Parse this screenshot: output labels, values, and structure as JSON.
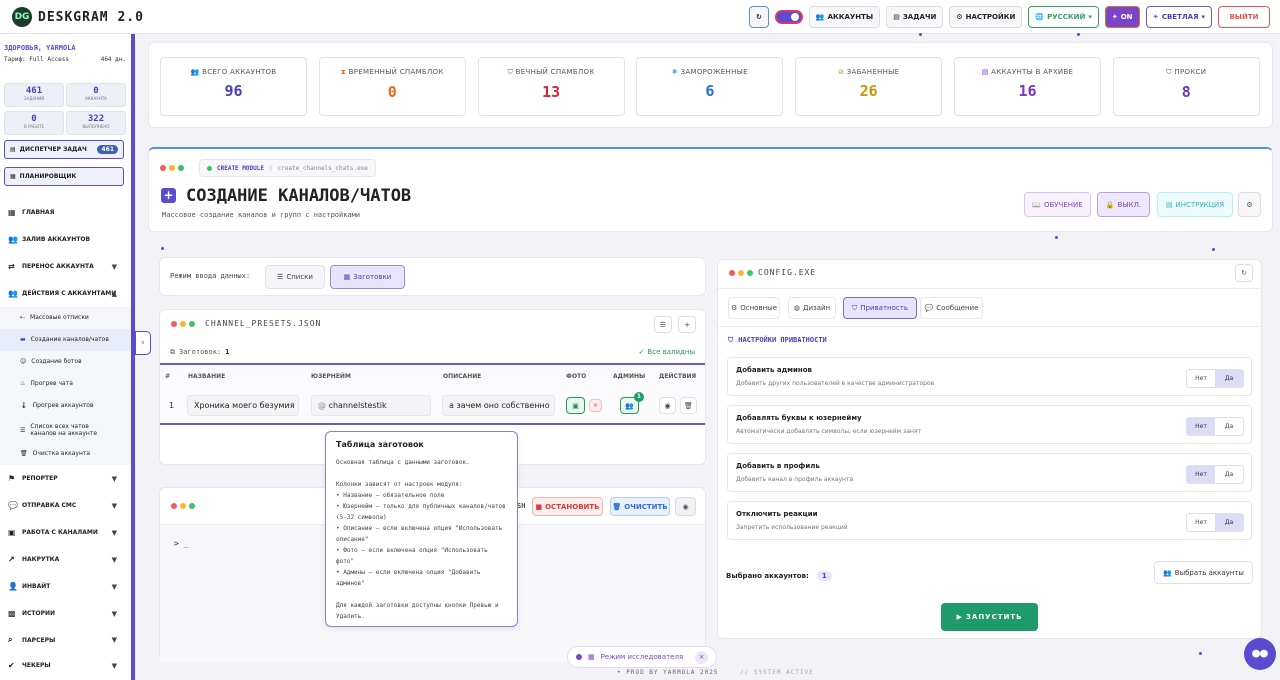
{
  "app": {
    "logo": "DG",
    "title": "DESKGRAM 2.0"
  },
  "topbar": {
    "accounts": "АККАУНТЫ",
    "tasks": "ЗАДАЧИ",
    "settings": "НАСТРОЙКИ",
    "language": "РУССКИЙ",
    "on": "ON",
    "theme": "СВЕТЛАЯ",
    "logout": "ВЫЙТИ"
  },
  "sidebar": {
    "user": "ЗДОРОВЬЯ, YARMOLA",
    "tariff_label": "Тариф: Full Access",
    "tariff_days": "464 дн.",
    "stats": [
      {
        "v": "461",
        "l": "заданий"
      },
      {
        "v": "0",
        "l": "аккаунта"
      },
      {
        "v": "0",
        "l": "в работе"
      },
      {
        "v": "322",
        "l": "выполнено"
      }
    ],
    "dispatcher": "ДИСПЕТЧЕР ЗАДАЧ",
    "dispatcher_count": "461",
    "planner": "ПЛАНИРОВЩИК",
    "items": [
      {
        "label": "ГЛАВНАЯ",
        "arrow": ""
      },
      {
        "label": "ЗАЛИВ АККАУНТОВ",
        "arrow": ""
      },
      {
        "label": "ПЕРЕНОС АККАУНТА",
        "arrow": "▼"
      },
      {
        "label": "ДЕЙСТВИЯ С АККАУНТАМИ",
        "arrow": "▲"
      }
    ],
    "subitems": [
      "Массовые отписки",
      "Создание каналов/чатов",
      "Создание ботов",
      "Прогрев чата",
      "Прогрев аккаунтов",
      "Список всех чатов каналов на аккаунте",
      "Очистка аккаунта"
    ],
    "items2": [
      "РЕПОРТЕР",
      "ОТПРАВКА СМС",
      "РАБОТА С КАНАЛАМИ",
      "НАКРУТКА",
      "ИНВАЙТ",
      "ИСТОРИИ",
      "ПАРСЕРЫ",
      "ЧЕКЕРЫ"
    ]
  },
  "stats_cards": [
    {
      "label": "ВСЕГО АККАУНТОВ",
      "value": "96",
      "color": "#4a3fb8"
    },
    {
      "label": "ВРЕМЕННЫЙ СПАМБЛОК",
      "value": "0",
      "color": "#e4691b"
    },
    {
      "label": "ВЕЧНЫЙ СПАМБЛОК",
      "value": "13",
      "color": "#d7263d"
    },
    {
      "label": "ЗАМОРОЖЕННЫЕ",
      "value": "6",
      "color": "#2b6fd6"
    },
    {
      "label": "ЗАБАНЕННЫЕ",
      "value": "26",
      "color": "#c29a0c"
    },
    {
      "label": "АККАУНТЫ В АРХИВЕ",
      "value": "16",
      "color": "#7b35c9"
    },
    {
      "label": "ПРОКСИ",
      "value": "8",
      "color": "#6a35c9"
    }
  ],
  "module": {
    "tag": "CREATE MODULE",
    "file": "create_channels_chats.exe",
    "title": "СОЗДАНИЕ КАНАЛОВ/ЧАТОВ",
    "subtitle": "Массовое создание каналов и групп с настройками",
    "btn_learn": "ОБУЧЕНИЕ",
    "btn_off": "ВЫКЛ.",
    "btn_instr": "ИНСТРУКЦИЯ"
  },
  "input_mode": {
    "label": "Режим ввода данных:",
    "lists": "Списки",
    "presets": "Заготовки"
  },
  "presets": {
    "file": "CHANNEL_PRESETS.JSON",
    "count_label": "Заготовок:",
    "count": "1",
    "valid": "Все валидны",
    "headers": [
      "#",
      "НАЗВАНИЕ",
      "ЮЗЕРНЕЙМ",
      "ОПИСАНИЕ",
      "ФОТО",
      "АДМИНЫ",
      "ДЕЙСТВИЯ"
    ],
    "row": {
      "n": "1",
      "name": "Хроника моего безумия",
      "username": "channelstestik",
      "desc": "а зачем оно собственно",
      "admins": "1"
    }
  },
  "tooltip": {
    "title": "Таблица заготовок",
    "body": "Основная таблица с данными заготовок.\n\nКолонки зависят от настроек модуля:\n• Название — обязательное поле\n• Юзернейм — только для публичных каналов/чатов (5-32 символа)\n• Описание — если включена опция \"Использовать описание\"\n• Фото — если включена опция \"Использовать фото\"\n• Админы — если включена опция \"Добавить админов\"\n\nДля каждой заготовки доступны кнопки Превью и Удалить."
  },
  "console": {
    "stop": "ОСТАНОВИТЬ",
    "clear": "ОЧИСТИТЬ",
    "prompt": "> _",
    "partial": "SH"
  },
  "config": {
    "file": "CONFIG.EXE",
    "tabs": [
      "Основные",
      "Дизайн",
      "Приватность",
      "Сообщение"
    ],
    "section": "НАСТРОЙКИ ПРИВАТНОСТИ",
    "rows": [
      {
        "title": "Добавить админов",
        "desc": "Добавить других пользователей в качестве администраторов",
        "no": "Нет",
        "yes": "Да",
        "sel": "yes"
      },
      {
        "title": "Добавлять буквы к юзернейму",
        "desc": "Автоматически добавлять символы, если юзернейм занят",
        "no": "Нет",
        "yes": "Да",
        "sel": "no"
      },
      {
        "title": "Добавить в профиль",
        "desc": "Добавить канал в профиль аккаунта",
        "no": "Нет",
        "yes": "Да",
        "sel": "no"
      },
      {
        "title": "Отключить реакции",
        "desc": "Запретить использование реакций",
        "no": "Нет",
        "yes": "Да",
        "sel": "yes"
      }
    ],
    "selected_label": "Выбрано аккаунтов:",
    "selected_count": "1",
    "choose": "Выбрать аккаунты",
    "run": "ЗАПУСТИТЬ"
  },
  "footer": {
    "research": "Режим исследователя",
    "prod": "PROD BY YARMOLA 2025",
    "system": "// SYSTEM ACTIVE"
  },
  "colors": {
    "accent": "#5a4bd1",
    "green": "#1f9a6a"
  }
}
